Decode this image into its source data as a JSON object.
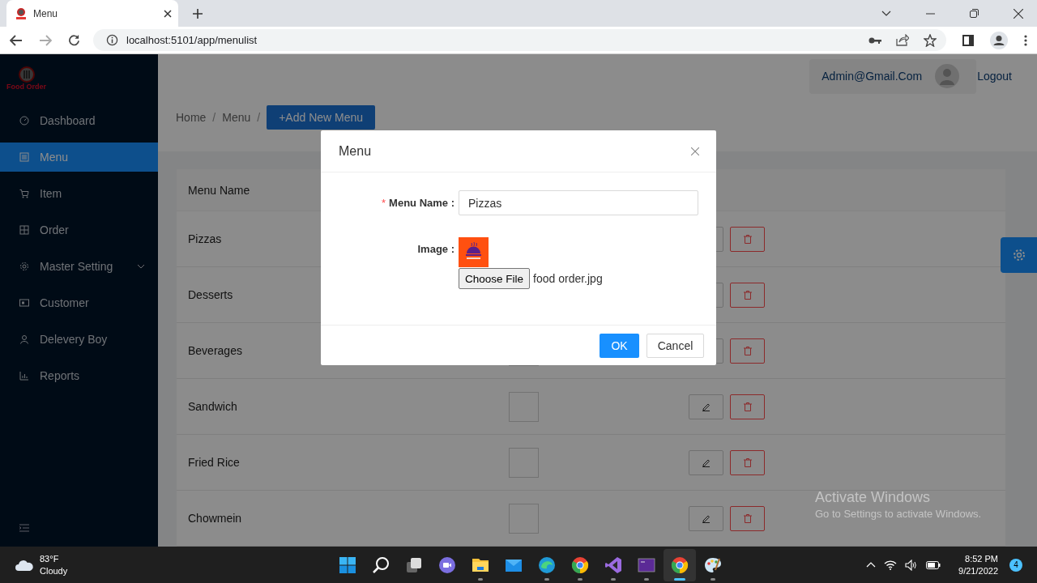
{
  "browser": {
    "tab_title": "Menu",
    "url": "localhost:5101/app/menulist"
  },
  "sidebar": {
    "logo": "Food Order",
    "items": [
      {
        "label": "Dashboard",
        "selected": false,
        "has_submenu": false
      },
      {
        "label": "Menu",
        "selected": true,
        "has_submenu": false
      },
      {
        "label": "Item",
        "selected": false,
        "has_submenu": false
      },
      {
        "label": "Order",
        "selected": false,
        "has_submenu": false
      },
      {
        "label": "Master Setting",
        "selected": false,
        "has_submenu": true
      },
      {
        "label": "Customer",
        "selected": false,
        "has_submenu": false
      },
      {
        "label": "Delevery Boy",
        "selected": false,
        "has_submenu": false
      },
      {
        "label": "Reports",
        "selected": false,
        "has_submenu": false
      }
    ]
  },
  "header": {
    "user": "Admin@Gmail.Com",
    "logout": "Logout"
  },
  "breadcrumb": [
    {
      "label": "Home",
      "separator": "/"
    },
    {
      "label": "Menu",
      "separator": "/"
    }
  ],
  "add_button": "+Add New Menu",
  "table": {
    "columns": [
      "Menu Name"
    ],
    "rows": [
      {
        "name": "Pizzas"
      },
      {
        "name": "Desserts"
      },
      {
        "name": "Beverages"
      },
      {
        "name": "Sandwich"
      },
      {
        "name": "Fried Rice"
      },
      {
        "name": "Chowmein"
      }
    ]
  },
  "modal": {
    "title": "Menu",
    "name_label": "Menu Name :",
    "required_mark": "*",
    "name_value": "Pizzas",
    "image_label": "Image :",
    "file_button": "Choose File",
    "file_name": "food order.jpg",
    "ok": "OK",
    "cancel": "Cancel"
  },
  "os_notice": {
    "title": "Activate Windows",
    "subtitle": "Go to Settings to activate Windows."
  },
  "taskbar": {
    "temperature": "83°F",
    "weather": "Cloudy",
    "time": "8:52 PM",
    "date": "9/21/2022",
    "notifications": "4",
    "apps": [
      {
        "kind": "start",
        "running": false,
        "selected": false
      },
      {
        "kind": "search",
        "running": false,
        "selected": false
      },
      {
        "kind": "taskview",
        "running": false,
        "selected": false
      },
      {
        "kind": "chat",
        "running": false,
        "selected": false
      },
      {
        "kind": "folder",
        "running": true,
        "selected": false
      },
      {
        "kind": "mail",
        "running": false,
        "selected": false
      },
      {
        "kind": "edge",
        "running": true,
        "selected": false
      },
      {
        "kind": "chrome",
        "running": true,
        "selected": false
      },
      {
        "kind": "studio",
        "running": true,
        "selected": false
      },
      {
        "kind": "terminal",
        "running": true,
        "selected": false
      },
      {
        "kind": "chrome",
        "running": true,
        "selected": true
      },
      {
        "kind": "paint",
        "running": true,
        "selected": false
      }
    ]
  }
}
